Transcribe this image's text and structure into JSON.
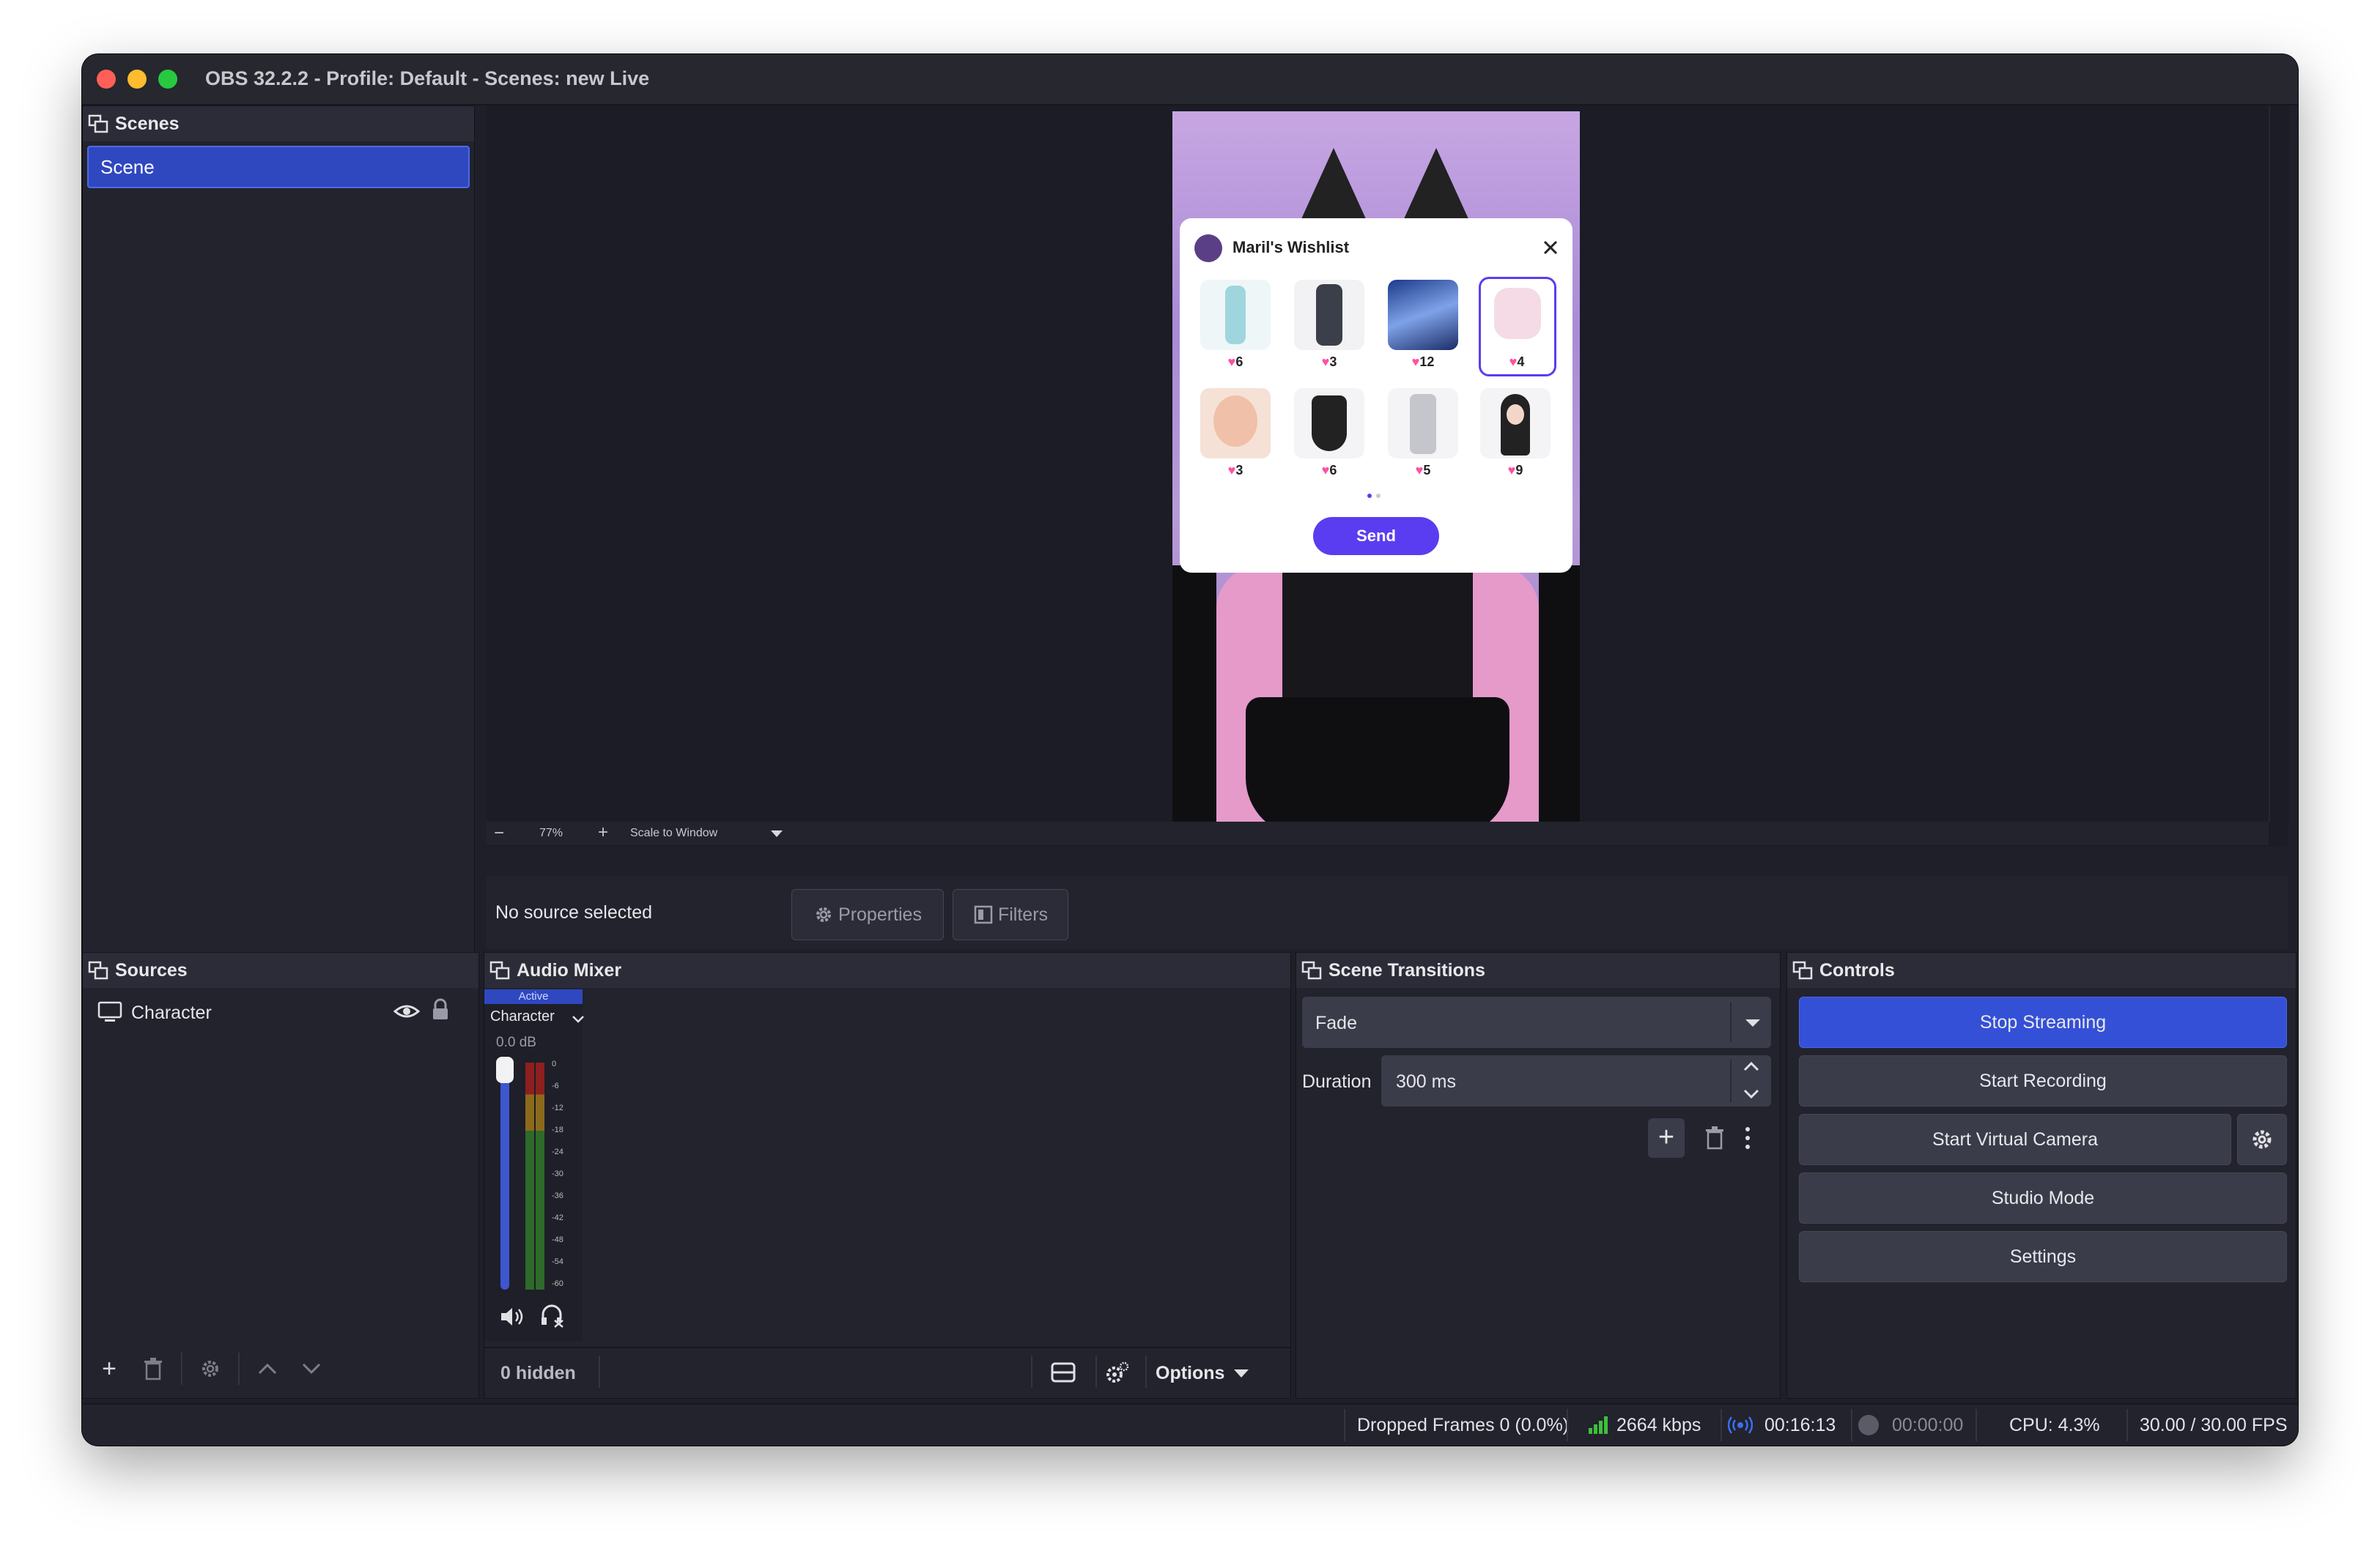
{
  "window": {
    "title": "OBS 32.2.2 - Profile: Default - Scenes: new Live"
  },
  "scenes": {
    "header": "Scenes",
    "items": [
      {
        "label": "Scene",
        "selected": true
      }
    ]
  },
  "preview": {
    "zoom": "77%",
    "scale_mode": "Scale to Window",
    "wishlist": {
      "title": "Maril's Wishlist",
      "items": [
        {
          "count": "6"
        },
        {
          "count": "3"
        },
        {
          "count": "12"
        },
        {
          "count": "4",
          "selected": true
        },
        {
          "count": "3"
        },
        {
          "count": "6"
        },
        {
          "count": "5"
        },
        {
          "count": "9"
        }
      ],
      "send_label": "Send"
    }
  },
  "context_bar": {
    "no_source": "No source selected",
    "properties_label": "Properties",
    "filters_label": "Filters"
  },
  "sources": {
    "header": "Sources",
    "items": [
      {
        "label": "Character",
        "visible": true,
        "locked": true
      }
    ]
  },
  "audio_mixer": {
    "header": "Audio Mixer",
    "channel": {
      "status": "Active",
      "name": "Character",
      "volume_db": "0.0 dB",
      "volume_level": 1.0,
      "scale": [
        "0",
        "-6",
        "-12",
        "-18",
        "-24",
        "-30",
        "-36",
        "-42",
        "-48",
        "-54",
        "-60"
      ]
    },
    "hidden_count": "0 hidden",
    "options_label": "Options"
  },
  "scene_transitions": {
    "header": "Scene Transitions",
    "transition": "Fade",
    "duration_label": "Duration",
    "duration_value": "300 ms"
  },
  "controls": {
    "header": "Controls",
    "stop_streaming": "Stop Streaming",
    "start_recording": "Start Recording",
    "start_virtual_camera": "Start Virtual Camera",
    "studio_mode": "Studio Mode",
    "settings": "Settings"
  },
  "status_bar": {
    "dropped_frames": "Dropped Frames 0 (0.0%)",
    "bitrate": "2664 kbps",
    "stream_time": "00:16:13",
    "record_time": "00:00:00",
    "cpu": "CPU: 4.3%",
    "fps": "30.00 / 30.00 FPS"
  },
  "colors": {
    "accent": "#2f48c0",
    "accent_button": "#3450d6",
    "panel": "#22232d",
    "header": "#2b2c37",
    "wishlist_purple": "#5a3df0",
    "traffic_red": "#ff5f57",
    "traffic_yellow": "#febc2e",
    "traffic_green": "#28c840"
  }
}
